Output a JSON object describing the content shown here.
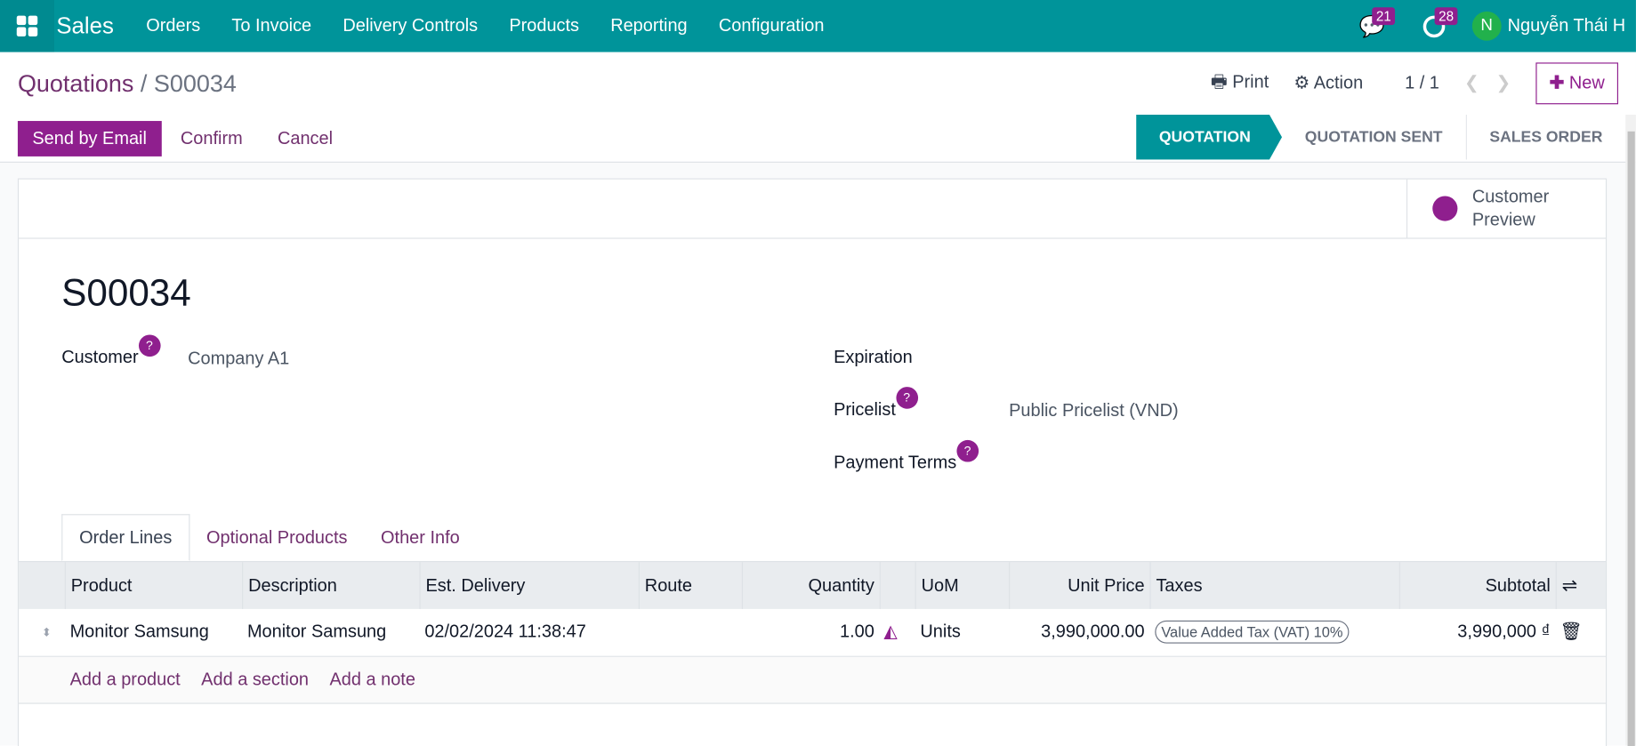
{
  "nav": {
    "app": "Sales",
    "menu": [
      "Orders",
      "To Invoice",
      "Delivery Controls",
      "Products",
      "Reporting",
      "Configuration"
    ],
    "messages_count": "21",
    "activities_count": "28",
    "avatar_initial": "N",
    "user": "Nguyễn Thái H"
  },
  "control": {
    "breadcrumb_parent": "Quotations",
    "breadcrumb_sep": "/",
    "record": "S00034",
    "print": "Print",
    "action": "Action",
    "pager": "1 / 1",
    "new": "New"
  },
  "status": {
    "send_email": "Send by Email",
    "confirm": "Confirm",
    "cancel": "Cancel",
    "stages": [
      "QUOTATION",
      "QUOTATION SENT",
      "SALES ORDER"
    ],
    "active_stage": "QUOTATION"
  },
  "form": {
    "customer_preview_1": "Customer",
    "customer_preview_2": "Preview",
    "name": "S00034",
    "customer_label": "Customer",
    "customer": "Company A1",
    "expiration_label": "Expiration",
    "pricelist_label": "Pricelist",
    "pricelist": "Public Pricelist (VND)",
    "payment_terms_label": "Payment Terms",
    "help": "?"
  },
  "tabs": [
    "Order Lines",
    "Optional Products",
    "Other Info"
  ],
  "table": {
    "headers": [
      "Product",
      "Description",
      "Est. Delivery",
      "Route",
      "Quantity",
      "UoM",
      "Unit Price",
      "Taxes",
      "Subtotal"
    ],
    "rows": [
      {
        "product": "Monitor Samsung",
        "description": "Monitor Samsung",
        "delivery": "02/02/2024 11:38:47",
        "route": "",
        "quantity": "1.00",
        "uom": "Units",
        "unit_price": "3,990,000.00",
        "tax": "Value Added Tax (VAT) 10%",
        "subtotal": "3,990,000 ₫"
      }
    ],
    "add_product": "Add a product",
    "add_section": "Add a section",
    "add_note": "Add a note"
  },
  "colors": {
    "brand": "#00949a",
    "accent": "#8f1f8e"
  }
}
